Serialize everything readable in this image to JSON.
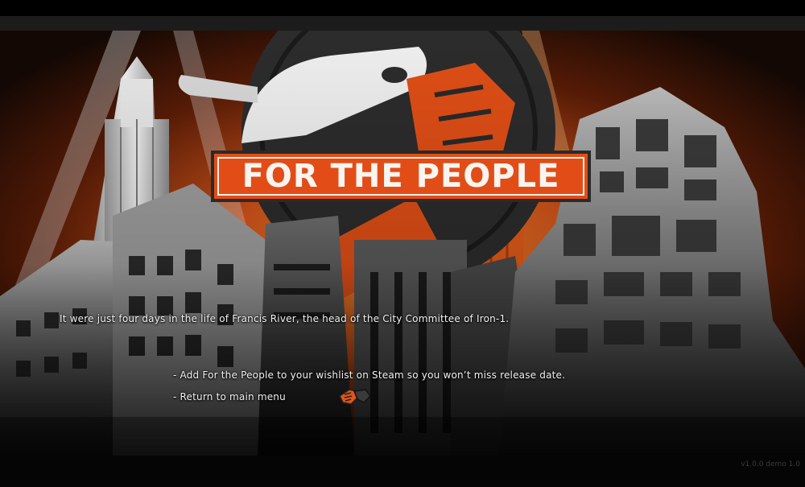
{
  "logo": {
    "title": "FOR THE PEOPLE"
  },
  "dialogue": {
    "intro": "It were just four days in the life of Francis River, the head of the City Committee of Iron-1.",
    "options": [
      {
        "label": "- Add For the People to your wishlist on Steam so you won’t miss release date."
      },
      {
        "label": "- Return to main menu"
      }
    ]
  },
  "footer": {
    "version": "v1.0.0 demo 1.0"
  },
  "colors": {
    "accent": "#e24d17",
    "sky_glow": "#d0531a",
    "building": "#8a8a8a"
  },
  "icons": {
    "cursor": "hand-cursor-icon"
  }
}
